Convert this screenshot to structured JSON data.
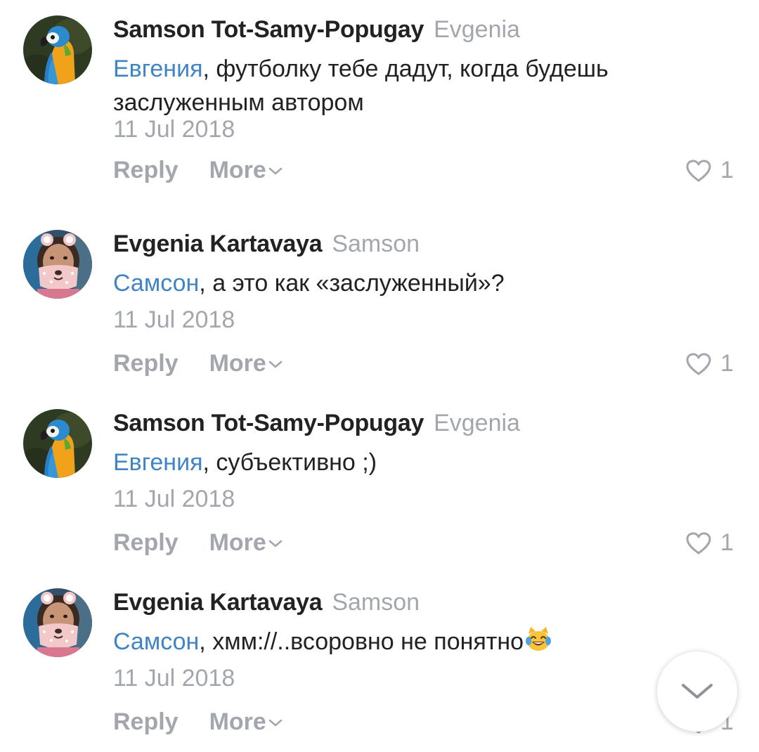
{
  "comments": [
    {
      "author": "Samson Tot-Samy-Popugay",
      "reply_to": "Evgenia",
      "mention": "Евгения",
      "text": ", футболку тебе дадут, когда будешь заслуженным автором",
      "date": "11 Jul 2018",
      "reply_label": "Reply",
      "more_label": "More",
      "likes": "1",
      "avatar_icon": "parrot-avatar"
    },
    {
      "author": "Evgenia Kartavaya",
      "reply_to": "Samson",
      "mention": "Самсон",
      "text": ", а это как «заслуженный»?",
      "date": "11 Jul 2018",
      "reply_label": "Reply",
      "more_label": "More",
      "likes": "1",
      "avatar_icon": "girl-avatar"
    },
    {
      "author": "Samson Tot-Samy-Popugay",
      "reply_to": "Evgenia",
      "mention": "Евгения",
      "text": ", субъективно ;)",
      "date": "11 Jul 2018",
      "reply_label": "Reply",
      "more_label": "More",
      "likes": "1",
      "avatar_icon": "parrot-avatar"
    },
    {
      "author": "Evgenia Kartavaya",
      "reply_to": "Samson",
      "mention": "Самсон",
      "text": ", хмм://..всоровно не понятно",
      "date": "11 Jul 2018",
      "reply_label": "Reply",
      "more_label": "More",
      "likes": "1",
      "avatar_icon": "girl-avatar",
      "emoji": "cat-tears-of-joy-emoji"
    }
  ],
  "colors": {
    "mention": "#3f84c4",
    "muted": "#a3a7ad",
    "text": "#222222"
  },
  "scroll_button_icon": "chevron-down-icon"
}
